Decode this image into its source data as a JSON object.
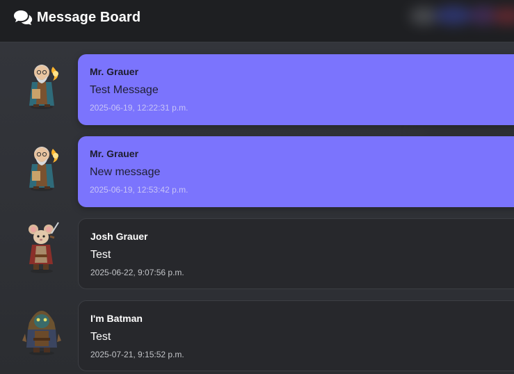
{
  "header": {
    "title": "Message Board",
    "icon": "comments-icon"
  },
  "colors": {
    "own_bubble": "#7b74fd",
    "other_bubble": "#27282c",
    "header_bg": "#1e1f22",
    "page_bg": "#2f3136"
  },
  "messages": [
    {
      "author": "Mr. Grauer",
      "text": "Test Message",
      "time": "2025-06-19, 12:22:31 p.m.",
      "own": true,
      "avatar": "wizard-avatar"
    },
    {
      "author": "Mr. Grauer",
      "text": "New message",
      "time": "2025-06-19, 12:53:42 p.m.",
      "own": true,
      "avatar": "wizard-avatar"
    },
    {
      "author": "Josh Grauer",
      "text": "Test",
      "time": "2025-06-22, 9:07:56 p.m.",
      "own": false,
      "avatar": "mouse-warrior-avatar"
    },
    {
      "author": "I'm Batman",
      "text": "Test",
      "time": "2025-07-21, 9:15:52 p.m.",
      "own": false,
      "avatar": "hooded-rogue-avatar"
    }
  ]
}
